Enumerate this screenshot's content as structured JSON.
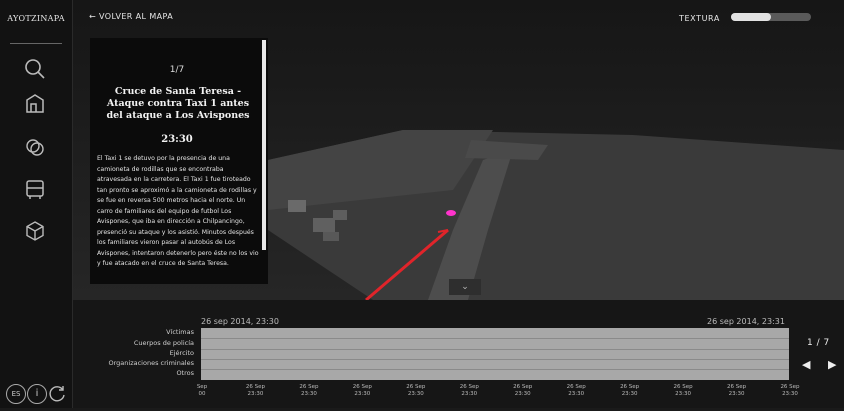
{
  "app": {
    "brand": "AYOTZINAPA"
  },
  "sidebar": {
    "icons": [
      "search-icon",
      "buildings-icon",
      "layers-icon",
      "bus-icon",
      "cube-icon"
    ],
    "bottom": [
      "es-icon",
      "info-icon",
      "refresh-icon"
    ],
    "bottom_labels": {
      "lang": "ES",
      "info": "i"
    }
  },
  "header": {
    "back_label": "← VOLVER AL MAPA",
    "texture_label": "TEXTURA",
    "texture_level": 0.5
  },
  "card": {
    "counter": "1/7",
    "title": "Cruce de Santa Teresa - Ataque contra Taxi 1 antes del ataque a Los Avispones",
    "time": "23:30",
    "body": "El Taxi 1 se detuvo por la presencia de una camioneta de rodillas que se encontraba atravesada en la carretera. El Taxi 1 fue tiroteado tan pronto se aproximó a la camioneta de rodillas y se fue en reversa 500 metros hacia el norte. Un carro de familiares del equipo de futbol Los Avispones, que iba en dirección a Chilpancingo, presenció su ataque y los asistió. Minutos después los familiares vieron pasar al autobús de Los Avispones, intentaron detenerlo pero éste no los vio y fue atacado en el cruce de Santa Teresa."
  },
  "timeline": {
    "date_left": "26 sep 2014, 23:30",
    "date_right": "26 sep 2014, 23:31",
    "categories": [
      "Víctimas",
      "Cuerpos de policía",
      "Ejército",
      "Organizaciones criminales",
      "Otros"
    ],
    "ticks": [
      [
        "Sep",
        "00"
      ],
      [
        "26 Sep",
        "23:30"
      ],
      [
        "26 Sep",
        "23:30"
      ],
      [
        "26 Sep",
        "23:30"
      ],
      [
        "26 Sep",
        "23:30"
      ],
      [
        "26 Sep",
        "23:30"
      ],
      [
        "26 Sep",
        "23:30"
      ],
      [
        "26 Sep",
        "23:30"
      ],
      [
        "26 Sep",
        "23:30"
      ],
      [
        "26 Sep",
        "23:30"
      ],
      [
        "26 Sep",
        "23:30"
      ],
      [
        "26 Sep",
        "23:30"
      ]
    ],
    "pager": "1 / 7",
    "prev": "◀",
    "next": "▶"
  },
  "map": {
    "chevron": "⌄",
    "marker_color": "#ff33cc",
    "path_color": "#e0242a"
  }
}
